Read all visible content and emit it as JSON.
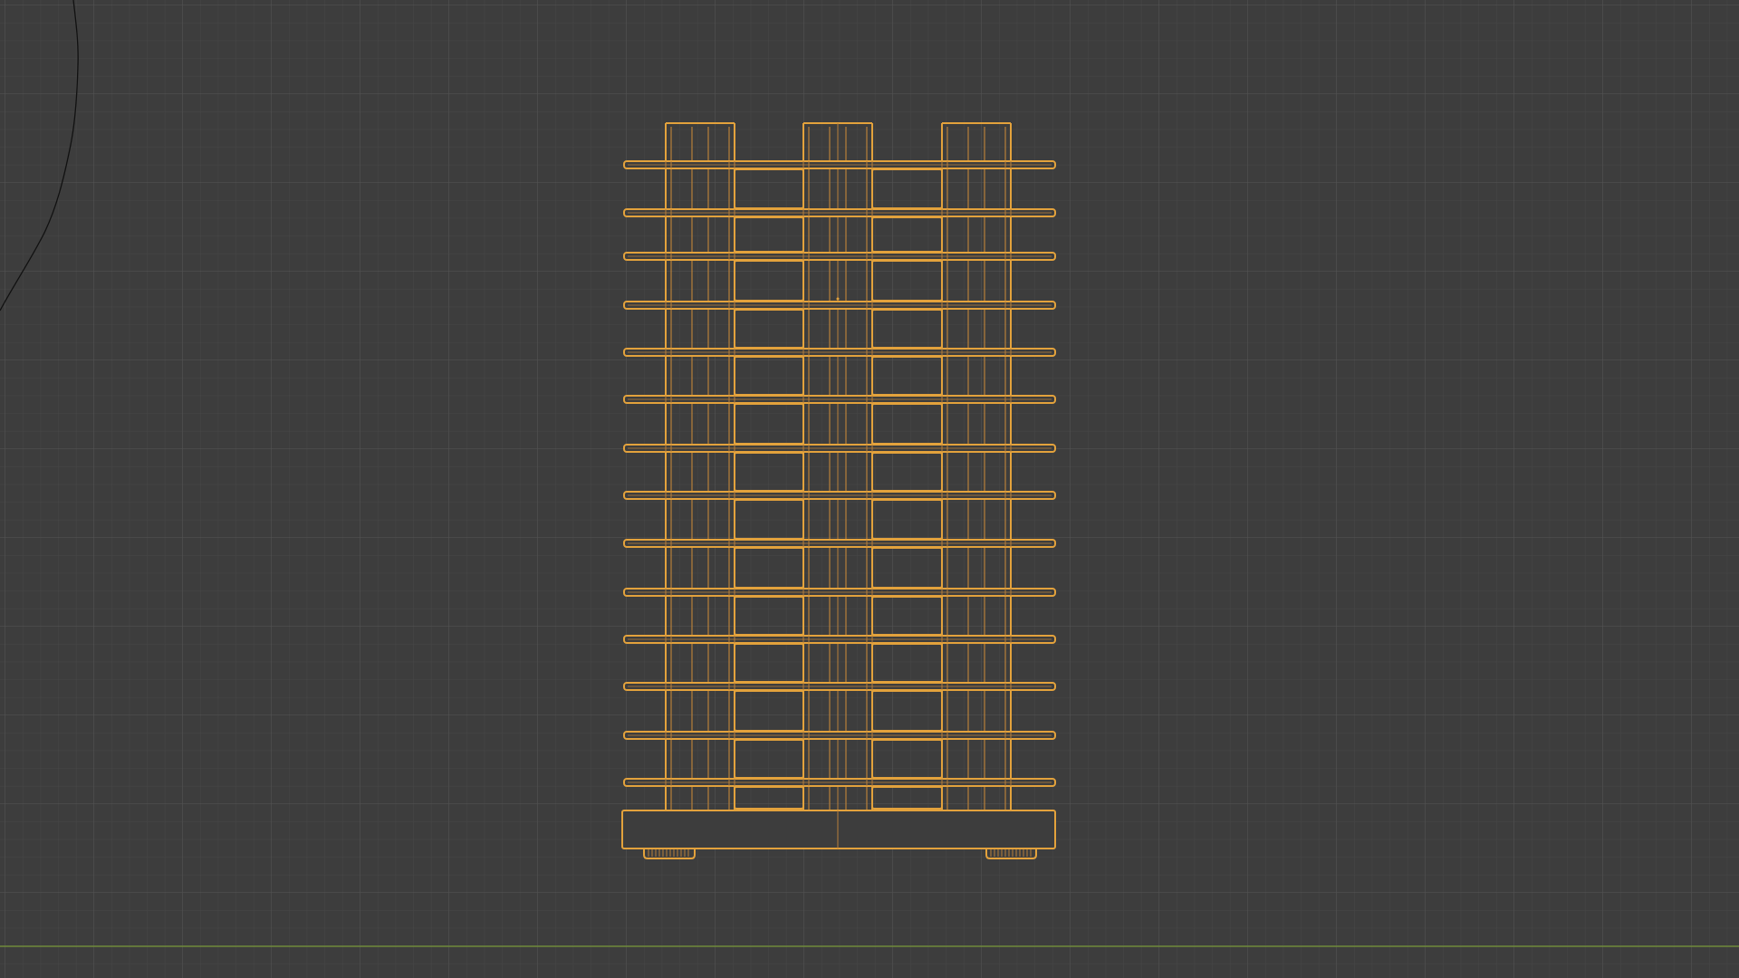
{
  "viewport": {
    "mode": "wireframe",
    "colors": {
      "background": "#3d3d3d",
      "grid_minor": "#474747",
      "grid_major": "#545454",
      "horizon": "#6f8a3a",
      "selected_wire": "#e3a23c",
      "inner_wire": "#b8803a",
      "curve": "#111111"
    },
    "object": {
      "name_icon": "shelf-rack-wireframe",
      "shelf_count": 14,
      "column_count": 3,
      "foot_count": 2
    }
  }
}
